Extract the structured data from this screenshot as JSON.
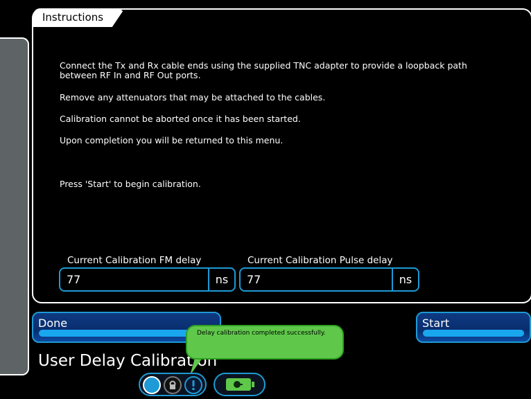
{
  "tab": {
    "label": "Instructions"
  },
  "instructions": [
    "Connect the Tx and Rx cable ends using the supplied TNC adapter to provide a loopback path",
    "between RF In and RF Out ports.",
    "Remove any attenuators that may be attached to the cables.",
    "Calibration cannot be aborted once it has been started.",
    "Upon completion you will be returned to this menu.",
    "Press 'Start' to begin calibration."
  ],
  "fields": {
    "fm_delay": {
      "label": "Current Calibration FM delay",
      "value": "77",
      "unit": "ns"
    },
    "pulse_delay": {
      "label": "Current Calibration Pulse delay",
      "value": "77",
      "unit": "ns"
    }
  },
  "buttons": {
    "done": "Done",
    "start": "Start"
  },
  "page_title": "User Delay Calibration",
  "toast": {
    "message": "Delay calibration completed successfully."
  },
  "status_icons": [
    "circle-status-icon",
    "lock-icon",
    "alert-icon",
    "battery-icon"
  ],
  "colors": {
    "accent": "#1e9ad6",
    "toast": "#5fc84a",
    "panel_border": "#ffffff",
    "background": "#000000"
  }
}
